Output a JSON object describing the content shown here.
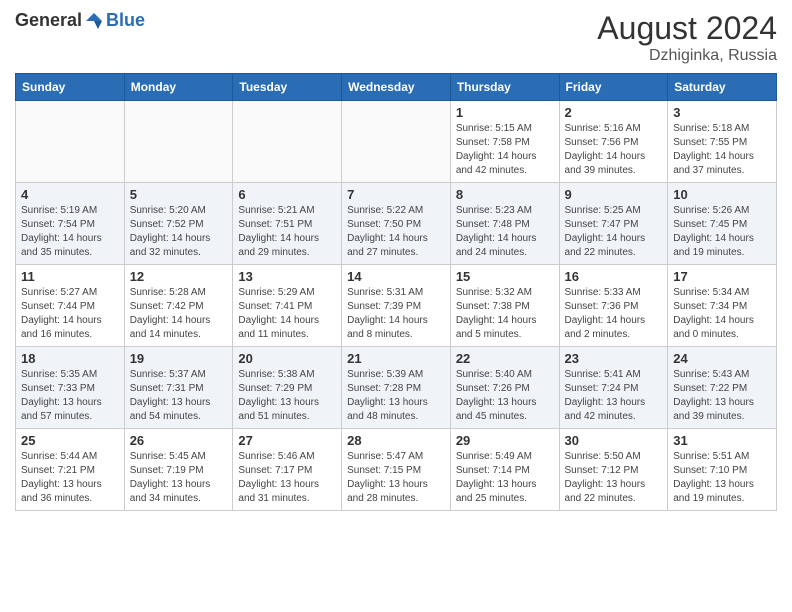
{
  "header": {
    "logo_general": "General",
    "logo_blue": "Blue",
    "month_year": "August 2024",
    "location": "Dzhiginka, Russia"
  },
  "days_of_week": [
    "Sunday",
    "Monday",
    "Tuesday",
    "Wednesday",
    "Thursday",
    "Friday",
    "Saturday"
  ],
  "weeks": [
    {
      "days": [
        {
          "date": "",
          "info": ""
        },
        {
          "date": "",
          "info": ""
        },
        {
          "date": "",
          "info": ""
        },
        {
          "date": "",
          "info": ""
        },
        {
          "date": "1",
          "info": "Sunrise: 5:15 AM\nSunset: 7:58 PM\nDaylight: 14 hours\nand 42 minutes."
        },
        {
          "date": "2",
          "info": "Sunrise: 5:16 AM\nSunset: 7:56 PM\nDaylight: 14 hours\nand 39 minutes."
        },
        {
          "date": "3",
          "info": "Sunrise: 5:18 AM\nSunset: 7:55 PM\nDaylight: 14 hours\nand 37 minutes."
        }
      ]
    },
    {
      "days": [
        {
          "date": "4",
          "info": "Sunrise: 5:19 AM\nSunset: 7:54 PM\nDaylight: 14 hours\nand 35 minutes."
        },
        {
          "date": "5",
          "info": "Sunrise: 5:20 AM\nSunset: 7:52 PM\nDaylight: 14 hours\nand 32 minutes."
        },
        {
          "date": "6",
          "info": "Sunrise: 5:21 AM\nSunset: 7:51 PM\nDaylight: 14 hours\nand 29 minutes."
        },
        {
          "date": "7",
          "info": "Sunrise: 5:22 AM\nSunset: 7:50 PM\nDaylight: 14 hours\nand 27 minutes."
        },
        {
          "date": "8",
          "info": "Sunrise: 5:23 AM\nSunset: 7:48 PM\nDaylight: 14 hours\nand 24 minutes."
        },
        {
          "date": "9",
          "info": "Sunrise: 5:25 AM\nSunset: 7:47 PM\nDaylight: 14 hours\nand 22 minutes."
        },
        {
          "date": "10",
          "info": "Sunrise: 5:26 AM\nSunset: 7:45 PM\nDaylight: 14 hours\nand 19 minutes."
        }
      ]
    },
    {
      "days": [
        {
          "date": "11",
          "info": "Sunrise: 5:27 AM\nSunset: 7:44 PM\nDaylight: 14 hours\nand 16 minutes."
        },
        {
          "date": "12",
          "info": "Sunrise: 5:28 AM\nSunset: 7:42 PM\nDaylight: 14 hours\nand 14 minutes."
        },
        {
          "date": "13",
          "info": "Sunrise: 5:29 AM\nSunset: 7:41 PM\nDaylight: 14 hours\nand 11 minutes."
        },
        {
          "date": "14",
          "info": "Sunrise: 5:31 AM\nSunset: 7:39 PM\nDaylight: 14 hours\nand 8 minutes."
        },
        {
          "date": "15",
          "info": "Sunrise: 5:32 AM\nSunset: 7:38 PM\nDaylight: 14 hours\nand 5 minutes."
        },
        {
          "date": "16",
          "info": "Sunrise: 5:33 AM\nSunset: 7:36 PM\nDaylight: 14 hours\nand 2 minutes."
        },
        {
          "date": "17",
          "info": "Sunrise: 5:34 AM\nSunset: 7:34 PM\nDaylight: 14 hours\nand 0 minutes."
        }
      ]
    },
    {
      "days": [
        {
          "date": "18",
          "info": "Sunrise: 5:35 AM\nSunset: 7:33 PM\nDaylight: 13 hours\nand 57 minutes."
        },
        {
          "date": "19",
          "info": "Sunrise: 5:37 AM\nSunset: 7:31 PM\nDaylight: 13 hours\nand 54 minutes."
        },
        {
          "date": "20",
          "info": "Sunrise: 5:38 AM\nSunset: 7:29 PM\nDaylight: 13 hours\nand 51 minutes."
        },
        {
          "date": "21",
          "info": "Sunrise: 5:39 AM\nSunset: 7:28 PM\nDaylight: 13 hours\nand 48 minutes."
        },
        {
          "date": "22",
          "info": "Sunrise: 5:40 AM\nSunset: 7:26 PM\nDaylight: 13 hours\nand 45 minutes."
        },
        {
          "date": "23",
          "info": "Sunrise: 5:41 AM\nSunset: 7:24 PM\nDaylight: 13 hours\nand 42 minutes."
        },
        {
          "date": "24",
          "info": "Sunrise: 5:43 AM\nSunset: 7:22 PM\nDaylight: 13 hours\nand 39 minutes."
        }
      ]
    },
    {
      "days": [
        {
          "date": "25",
          "info": "Sunrise: 5:44 AM\nSunset: 7:21 PM\nDaylight: 13 hours\nand 36 minutes."
        },
        {
          "date": "26",
          "info": "Sunrise: 5:45 AM\nSunset: 7:19 PM\nDaylight: 13 hours\nand 34 minutes."
        },
        {
          "date": "27",
          "info": "Sunrise: 5:46 AM\nSunset: 7:17 PM\nDaylight: 13 hours\nand 31 minutes."
        },
        {
          "date": "28",
          "info": "Sunrise: 5:47 AM\nSunset: 7:15 PM\nDaylight: 13 hours\nand 28 minutes."
        },
        {
          "date": "29",
          "info": "Sunrise: 5:49 AM\nSunset: 7:14 PM\nDaylight: 13 hours\nand 25 minutes."
        },
        {
          "date": "30",
          "info": "Sunrise: 5:50 AM\nSunset: 7:12 PM\nDaylight: 13 hours\nand 22 minutes."
        },
        {
          "date": "31",
          "info": "Sunrise: 5:51 AM\nSunset: 7:10 PM\nDaylight: 13 hours\nand 19 minutes."
        }
      ]
    }
  ],
  "colors": {
    "header_bg": "#2a6db5",
    "header_text": "#ffffff",
    "alt_row_bg": "#eef3f8"
  }
}
